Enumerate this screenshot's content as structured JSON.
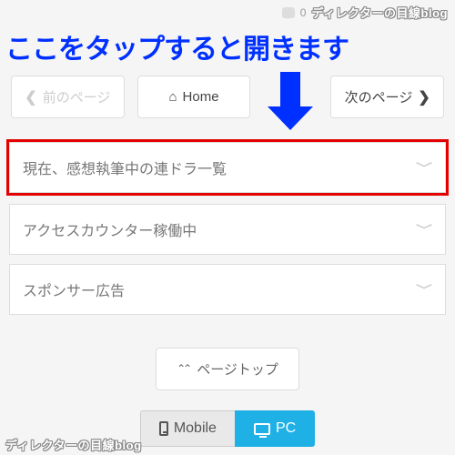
{
  "topbar": {
    "comment_count": "0",
    "blog_title": "ディレクターの目線blog"
  },
  "annotation": {
    "text": "ここをタップすると開きます"
  },
  "nav": {
    "prev_label": "前のページ",
    "home_label": "Home",
    "next_label": "次のページ"
  },
  "accordion": {
    "items": [
      {
        "label": "現在、感想執筆中の連ドラ一覧",
        "highlighted": true
      },
      {
        "label": "アクセスカウンター稼働中",
        "highlighted": false
      },
      {
        "label": "スポンサー広告",
        "highlighted": false
      }
    ]
  },
  "page_top": {
    "label": "ページトップ"
  },
  "view_switch": {
    "mobile_label": "Mobile",
    "pc_label": "PC",
    "active": "pc"
  },
  "colors": {
    "annotation_blue": "#0030ff",
    "highlight_red": "#e40000",
    "pc_active": "#1fb0e6"
  }
}
